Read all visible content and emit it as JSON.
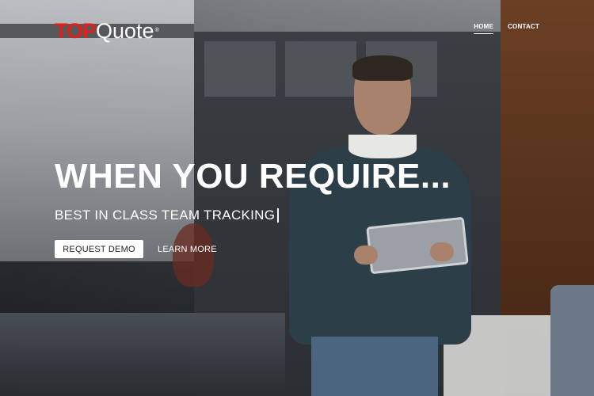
{
  "header": {
    "logo": {
      "part1": "TOP",
      "part2": "Quote",
      "mark": "®"
    },
    "nav": [
      {
        "label": "HOME",
        "active": true
      },
      {
        "label": "CONTACT",
        "active": false
      }
    ]
  },
  "hero": {
    "headline": "WHEN YOU REQUIRE...",
    "subheadline": "BEST IN CLASS TEAM TRACKING",
    "primary_button": "REQUEST DEMO",
    "secondary_button": "LEARN MORE"
  },
  "colors": {
    "brand_red": "#e0201b",
    "text": "#ffffff",
    "button_bg": "#ffffff",
    "button_text": "#222222"
  }
}
